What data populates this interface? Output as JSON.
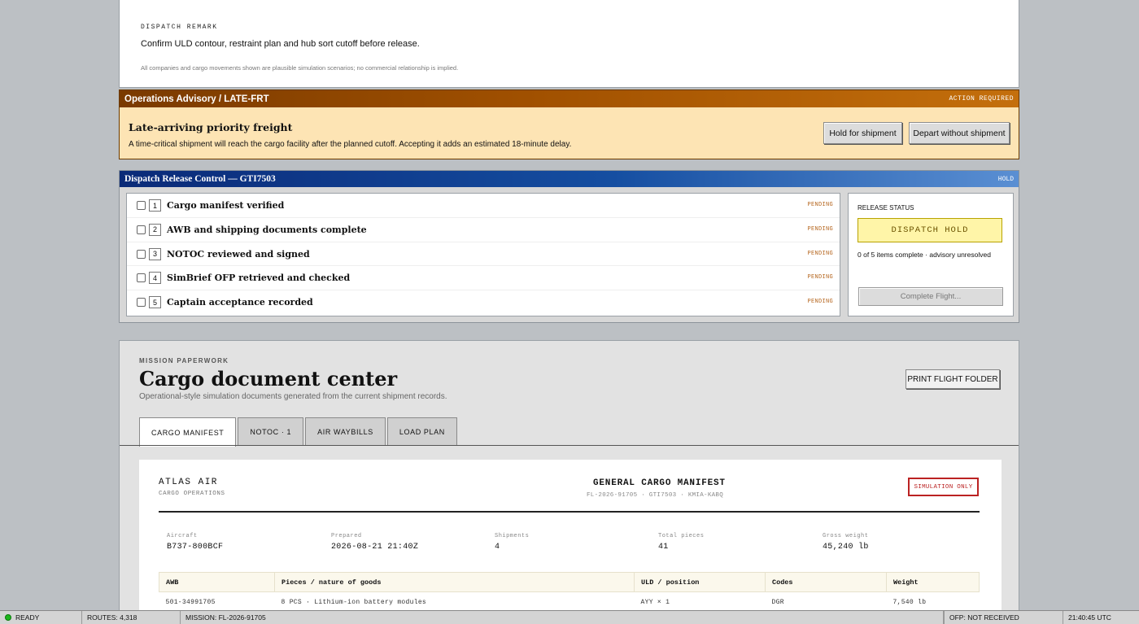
{
  "remark": {
    "label": "DISPATCH REMARK",
    "text": "Confirm ULD contour, restraint plan and hub sort cutoff before release.",
    "disclaimer": "All companies and cargo movements shown are plausible simulation scenarios; no commercial relationship is implied."
  },
  "advisory": {
    "title": "Operations Advisory / LATE-FRT",
    "status": "ACTION REQUIRED",
    "heading": "Late-arriving priority freight",
    "body": "A time-critical shipment will reach the cargo facility after the planned cutoff. Accepting it adds an estimated 18-minute delay.",
    "hold_label": "Hold for shipment",
    "depart_label": "Depart without shipment"
  },
  "release": {
    "title": "Dispatch Release Control — GTI7503",
    "state": "HOLD",
    "items": [
      {
        "num": "1",
        "label": "Cargo manifest verified",
        "status": "PENDING"
      },
      {
        "num": "2",
        "label": "AWB and shipping documents complete",
        "status": "PENDING"
      },
      {
        "num": "3",
        "label": "NOTOC reviewed and signed",
        "status": "PENDING"
      },
      {
        "num": "4",
        "label": "SimBrief OFP retrieved and checked",
        "status": "PENDING"
      },
      {
        "num": "5",
        "label": "Captain acceptance recorded",
        "status": "PENDING"
      }
    ],
    "status_label": "RELEASE STATUS",
    "status_value": "DISPATCH HOLD",
    "summary": "0 of 5 items complete · advisory unresolved",
    "complete_label": "Complete Flight..."
  },
  "docs": {
    "kicker": "MISSION PAPERWORK",
    "title": "Cargo document center",
    "subtitle": "Operational-style simulation documents generated from the current shipment records.",
    "print_label": "PRINT FLIGHT FOLDER",
    "tabs": [
      "CARGO MANIFEST",
      "NOTOC · 1",
      "AIR WAYBILLS",
      "LOAD PLAN"
    ],
    "sheet": {
      "company": "ATLAS AIR",
      "company_sub": "CARGO OPERATIONS",
      "doc_title": "GENERAL CARGO MANIFEST",
      "doc_ref": "FL-2026-91705 · GTI7503 · KMIA-KABQ",
      "stamp": "SIMULATION ONLY",
      "fields": [
        {
          "label": "Aircraft",
          "value": "B737-800BCF"
        },
        {
          "label": "Prepared",
          "value": "2026-08-21 21:40Z"
        },
        {
          "label": "Shipments",
          "value": "4"
        },
        {
          "label": "Total pieces",
          "value": "41"
        },
        {
          "label": "Gross weight",
          "value": "45,240 lb"
        }
      ],
      "columns": [
        "AWB",
        "Pieces / nature of goods",
        "ULD / position",
        "Codes",
        "Weight"
      ],
      "rows": [
        [
          "501-34991705",
          "8 PCS · Lithium-ion battery modules",
          "AYY × 1",
          "DGR",
          "7,540 lb"
        ]
      ]
    }
  },
  "statusbar": {
    "ready": "READY",
    "routes": "ROUTES: 4,318",
    "mission": "MISSION: FL-2026-91705",
    "ofp": "OFP: NOT RECEIVED",
    "clock": "21:40:45 UTC"
  }
}
